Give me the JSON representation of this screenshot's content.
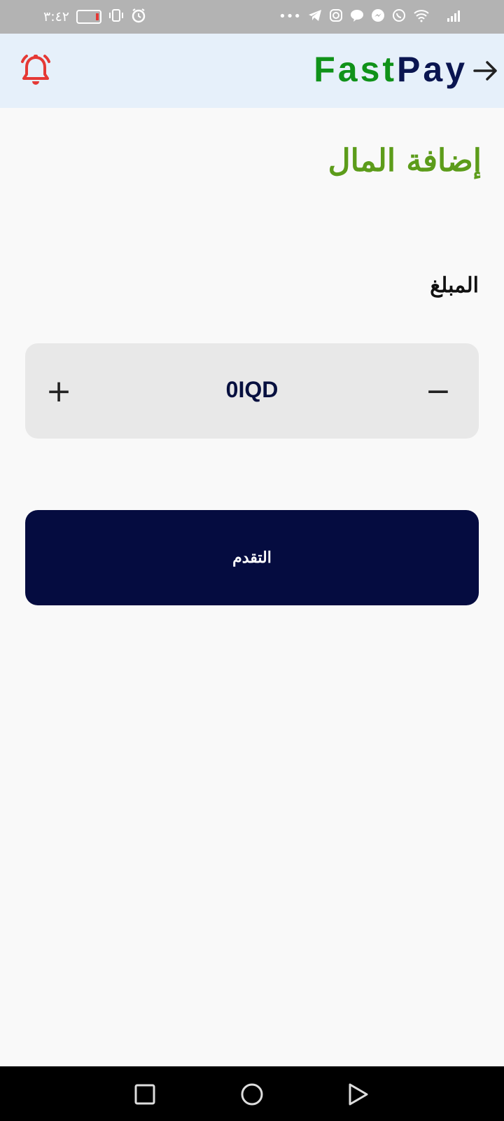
{
  "status_bar": {
    "time": "٣:٤٢",
    "more_dots": "•••"
  },
  "header": {
    "brand_fast": "Fast",
    "brand_pay": "Pay",
    "icons": [
      "bell-icon",
      "back-arrow-icon"
    ],
    "bell_color": "#e53935"
  },
  "main": {
    "title": "إضافة المال",
    "amount_label": "المبلغ",
    "stepper": {
      "plus": "+",
      "minus": "−",
      "value": "0IQD"
    },
    "proceed_label": "التقدم"
  },
  "colors": {
    "brand_green": "#109219",
    "brand_navy": "#0a1550",
    "title_green": "#5c9c1a",
    "button_bg": "#050c40",
    "header_bg": "#e6f0fa"
  },
  "nav": {
    "icons": [
      "recents-square-icon",
      "home-circle-icon",
      "back-triangle-icon"
    ]
  }
}
